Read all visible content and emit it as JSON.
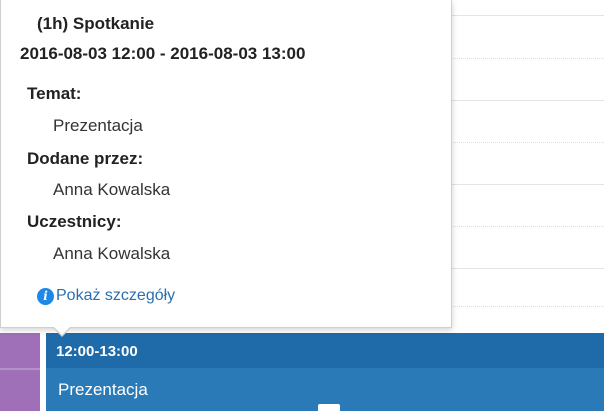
{
  "event": {
    "time": "12:00-13:00",
    "title": "Prezentacja"
  },
  "popover": {
    "title": "(1h) Spotkanie",
    "range": "2016-08-03 12:00 - 2016-08-03 13:00",
    "fields": [
      {
        "label": "Temat:",
        "value": "Prezentacja"
      },
      {
        "label": "Dodane przez:",
        "value": "Anna Kowalska"
      },
      {
        "label": "Uczestnicy:",
        "value": "Anna Kowalska"
      }
    ],
    "details_link": "Pokaż szczegóły",
    "details_icon": "info-icon"
  },
  "colors": {
    "event": "#2a7ab8",
    "event_header": "#1f6aa8",
    "left_strip": "#9f6fb8",
    "link": "#2a6fb0",
    "info_icon": "#1e88e5"
  }
}
